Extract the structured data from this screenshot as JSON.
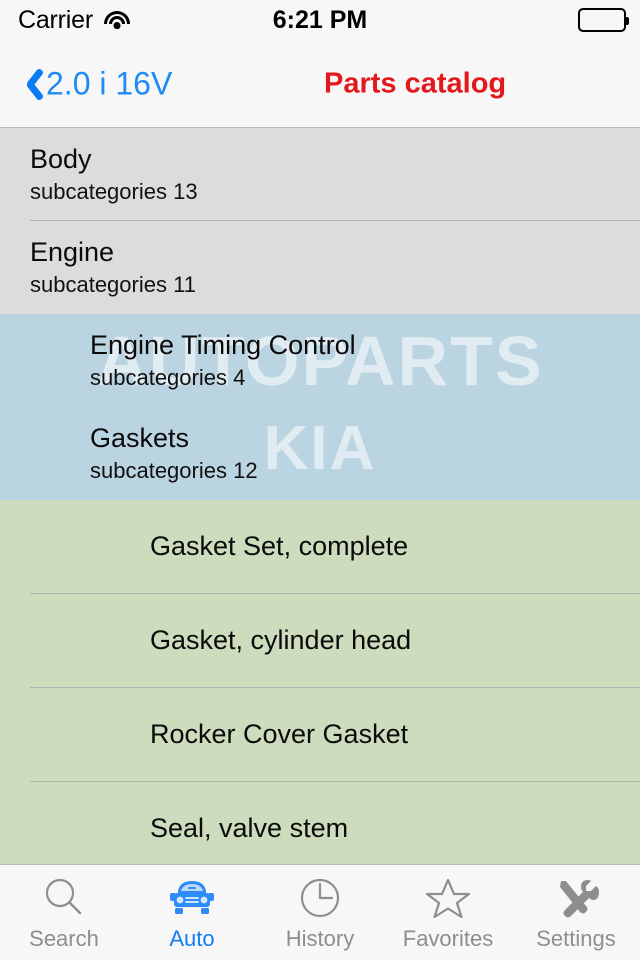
{
  "status_bar": {
    "carrier": "Carrier",
    "wifi_icon": "wifi-icon",
    "time": "6:21 PM",
    "battery_icon": "battery-full-icon"
  },
  "nav_bar": {
    "back_icon": "chevron-left-icon",
    "back_label": "2.0 i 16V",
    "title": "Parts catalog",
    "title_color": "#e2191c",
    "back_color": "#1f8bf5"
  },
  "watermark": {
    "line1": "AUTOPARTS",
    "line2": "KIA"
  },
  "colors": {
    "level1_bg": "#dcdcdc",
    "level2_bg": "#bbd4e1",
    "level3_bg": "#ccdcbc",
    "separator": "#b2b2b2",
    "chrome_bg": "#f7f7f7",
    "active_tab": "#127df4",
    "inactive_tab": "#8e8e8e"
  },
  "list": {
    "level1": [
      {
        "title": "Body",
        "subtitle": "subcategories 13"
      },
      {
        "title": "Engine",
        "subtitle": "subcategories 11"
      }
    ],
    "level2": [
      {
        "title": "Engine Timing Control",
        "subtitle": "subcategories 4"
      },
      {
        "title": "Gaskets",
        "subtitle": "subcategories 12"
      }
    ],
    "level3": [
      {
        "title": "Gasket Set, complete"
      },
      {
        "title": "Gasket, cylinder head"
      },
      {
        "title": "Rocker Cover Gasket"
      },
      {
        "title": "Seal, valve stem"
      }
    ]
  },
  "tab_bar": {
    "tabs": [
      {
        "label": "Search",
        "icon": "search-icon",
        "active": false
      },
      {
        "label": "Auto",
        "icon": "car-icon",
        "active": true
      },
      {
        "label": "History",
        "icon": "clock-icon",
        "active": false
      },
      {
        "label": "Favorites",
        "icon": "star-icon",
        "active": false
      },
      {
        "label": "Settings",
        "icon": "tools-icon",
        "active": false
      }
    ]
  }
}
